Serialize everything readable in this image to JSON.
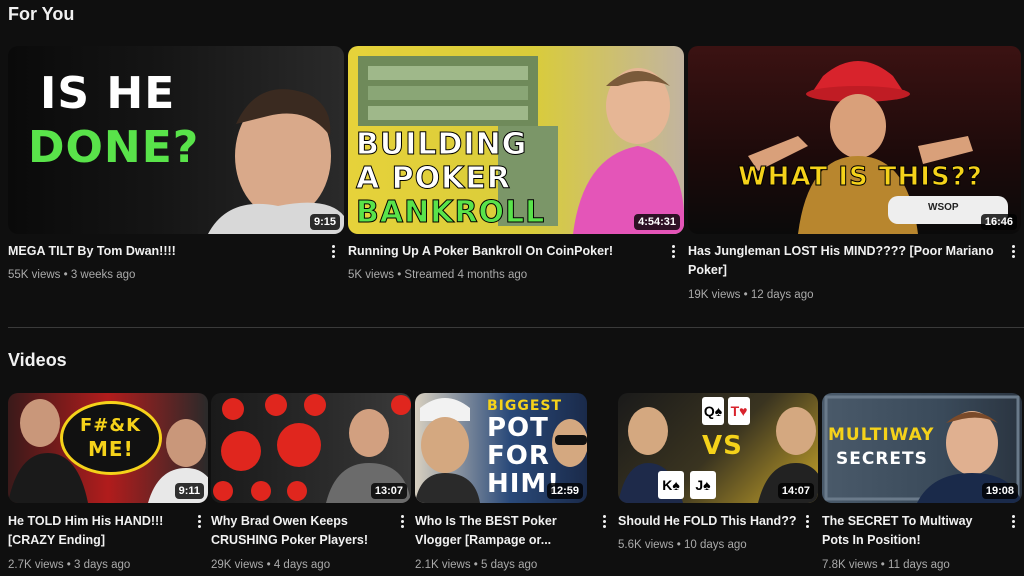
{
  "sections": {
    "for_you": {
      "title": "For You"
    },
    "videos": {
      "title": "Videos"
    }
  },
  "for_you_videos": [
    {
      "title": "MEGA TILT By Tom Dwan!!!!",
      "meta": "55K views • 3 weeks ago",
      "duration": "9:15",
      "thumb_text": [
        "IS HE",
        "DONE?"
      ]
    },
    {
      "title": "Running Up A Poker Bankroll On CoinPoker!",
      "meta": "5K views • Streamed 4 months ago",
      "duration": "4:54:31",
      "thumb_text": [
        "BUILDING",
        "A POKER",
        "BANKROLL"
      ]
    },
    {
      "title_line1": "Has Jungleman LOST His MIND???? [Poor Mariano",
      "title_line2": "Poker]",
      "meta": "19K views • 12 days ago",
      "duration": "16:46",
      "thumb_text": [
        "WHAT IS THIS??"
      ],
      "badge": "WSOP"
    }
  ],
  "videos": [
    {
      "title_line1": "He TOLD Him His HAND!!!",
      "title_line2": "[CRAZY Ending]",
      "meta": "2.7K views • 3 days ago",
      "duration": "9:11",
      "thumb_text": [
        "F#&K",
        "ME!"
      ]
    },
    {
      "title_line1": "Why Brad Owen Keeps",
      "title_line2": "CRUSHING Poker Players!",
      "meta": "29K views • 4 days ago",
      "duration": "13:07"
    },
    {
      "title_line1": "Who Is The BEST Poker",
      "title_line2": "Vlogger [Rampage or...",
      "meta": "2.1K views • 5 days ago",
      "duration": "12:59",
      "thumb_text": [
        "BIGGEST",
        "POT",
        "FOR",
        "HIM!"
      ]
    },
    {
      "title_line1": "Should He FOLD This Hand??",
      "meta": "5.6K views • 10 days ago",
      "duration": "14:07",
      "thumb_text": [
        "VS"
      ],
      "cards": [
        "Q♠",
        "T♥",
        "K♠",
        "J♠"
      ]
    },
    {
      "title_line1": "The SECRET To Multiway",
      "title_line2": "Pots In Position!",
      "meta": "7.8K views • 11 days ago",
      "duration": "19:08",
      "thumb_text": [
        "MULTIWAY",
        "SECRETS"
      ]
    }
  ]
}
